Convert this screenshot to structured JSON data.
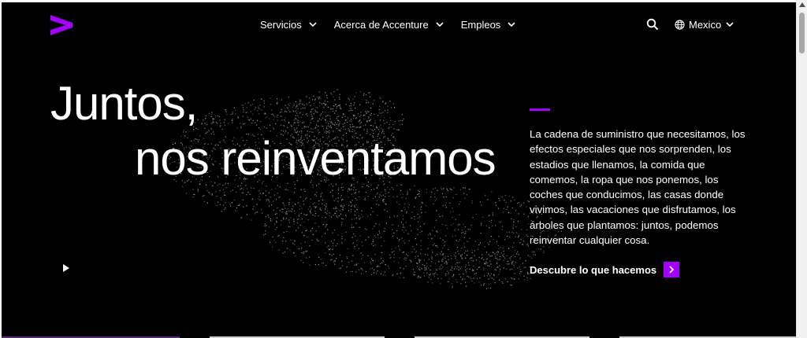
{
  "brand": {
    "logo_icon": "accenture-chevron-icon",
    "accent_color": "#a100ff"
  },
  "nav": {
    "items": [
      {
        "label": "Servicios"
      },
      {
        "label": "Acerca de Accenture"
      },
      {
        "label": "Empleos"
      }
    ]
  },
  "header": {
    "search_icon": "search-icon",
    "locale_label": "Mexico"
  },
  "hero": {
    "headline_line1": "Juntos,",
    "headline_line2": "nos reinventamos",
    "description": "La cadena de suministro que necesitamos, los efectos especiales que nos sorprenden, los estadios que llenamos, la comida que comemos, la ropa que nos ponemos, los coches que conducimos, las casas donde vivimos, las vacaciones que disfrutamos, los árboles que plantamos: juntos, podemos reinventar cualquier cosa.",
    "cta_label": "Descubre lo que hacemos",
    "play_icon": "play-icon"
  }
}
